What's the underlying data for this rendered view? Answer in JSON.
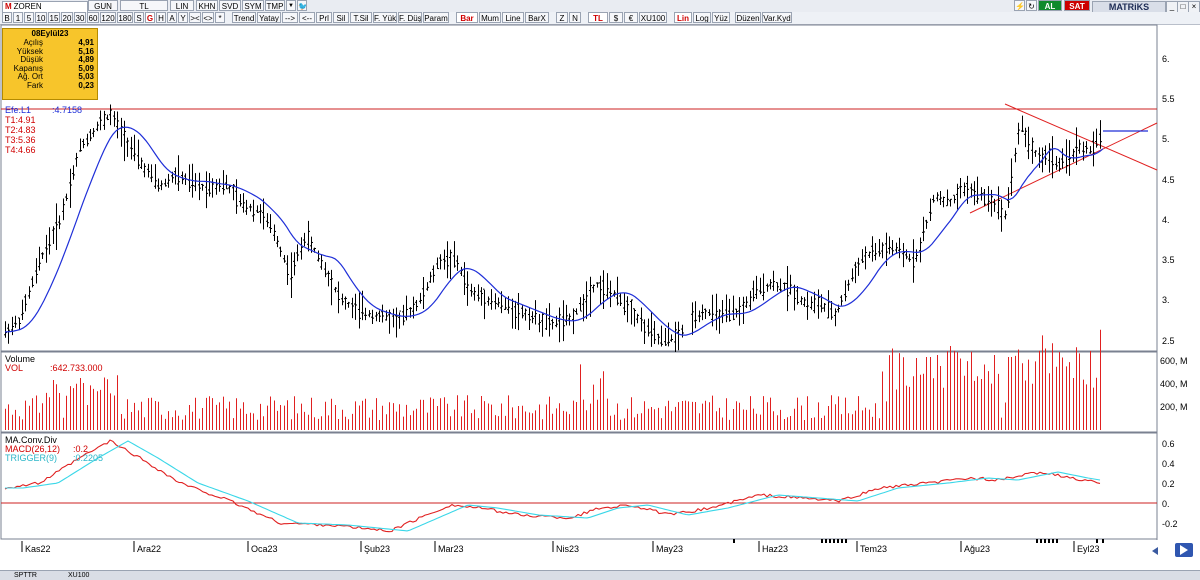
{
  "toolbar": {
    "symbol": "ZOREN",
    "period": "GUN",
    "currency": "TL",
    "scale": "LIN",
    "items_row1": [
      "KHN",
      "SVD",
      "SYM",
      "TMP"
    ],
    "brand": "MATRiKS",
    "al": "AL",
    "sat": "SAT"
  },
  "toolbar2": {
    "items": [
      "B",
      "1",
      "5",
      "10",
      "15",
      "20",
      "30",
      "60",
      "120",
      "180",
      "S",
      "G",
      "H",
      "A",
      "Y",
      "><",
      "<>",
      "*",
      "Trend",
      "Yatay",
      "-->",
      "<--",
      "Prl",
      "Sil",
      "T.Sil",
      "F. Yük",
      "F. Düş",
      "Param",
      "Bar",
      "Mum",
      "Line",
      "BarX",
      "Z",
      "N",
      "TL",
      "$",
      "€",
      "XU100",
      "Lin",
      "Log",
      "Yüz",
      "Düzen",
      "Var.Kyd"
    ]
  },
  "info": {
    "date": "08Eylül23",
    "rows": [
      {
        "label": "Açılış",
        "value": "4,91"
      },
      {
        "label": "Yüksek",
        "value": "5,16"
      },
      {
        "label": "Düşük",
        "value": "4,89"
      },
      {
        "label": "Kapanış",
        "value": "5,09"
      },
      {
        "label": "Ağ. Ort",
        "value": "5,03"
      },
      {
        "label": "Fark",
        "value": "0,23"
      }
    ]
  },
  "legend_price": {
    "efe": "Efe.L1",
    "efe_value": ":4.7158",
    "t1": "T1:4.91",
    "t2": "T2:4.83",
    "t3": "T3:5.36",
    "t4": "T4:4.66"
  },
  "legend_volume": {
    "title": "Volume",
    "vol": "VOL",
    "vol_value": ":642.733.000"
  },
  "legend_macd": {
    "title": "MA.Conv.Div",
    "macd": "MACD(26,12)",
    "macd_value": ":0.2",
    "trigger": "TRIGGER(9)",
    "trigger_value": ":0.2205"
  },
  "price_axis": [
    "6.",
    "5.5",
    "5.",
    "4.5",
    "4.",
    "3.5",
    "3.",
    "2.5"
  ],
  "volume_axis": [
    "600, M",
    "400, M",
    "200, M"
  ],
  "macd_axis": [
    "0.6",
    "0.4",
    "0.2",
    "0.",
    "-0.2"
  ],
  "date_axis": [
    "Kas22",
    "Ara22",
    "Oca23",
    "Şub23",
    "Mar23",
    "Nis23",
    "May23",
    "Haz23",
    "Tem23",
    "Ağu23",
    "Eyl23"
  ],
  "status": {
    "tab1": "SPTTR",
    "tab2": "XU100"
  },
  "colors": {
    "price_bars": "#000000",
    "ma_line": "#1f2fd8",
    "trend_lines": "#e02020",
    "volume_bars": "#e02020",
    "macd_line": "#e02020",
    "trigger_line": "#3ad7e8",
    "ref_lines": "#cc2020"
  }
}
